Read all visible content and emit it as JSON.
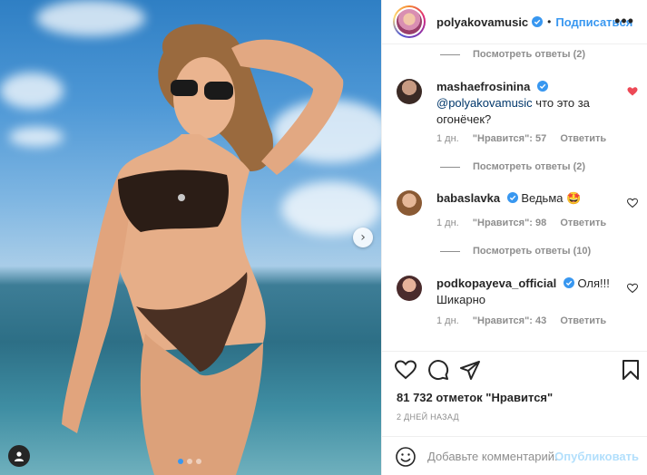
{
  "post": {
    "author": "polyakovamusic",
    "follow_label": "Подписаться",
    "more_label": "•••"
  },
  "replies": [
    {
      "label": "Посмотреть ответы (2)"
    },
    {
      "label": "Посмотреть ответы (2)"
    },
    {
      "label": "Посмотреть ответы (10)"
    }
  ],
  "comments": [
    {
      "user": "mashaefrosinina",
      "mention": "@polyakovamusic",
      "text": " что это за огонёчек?",
      "time": "1 дн.",
      "likes": "\"Нравится\": 57",
      "reply": "Ответить",
      "liked": true
    },
    {
      "user": "babaslavka",
      "mention": "",
      "text": "Ведьма 🤩",
      "time": "1 дн.",
      "likes": "\"Нравится\": 98",
      "reply": "Ответить",
      "liked": false
    },
    {
      "user": "podkopayeva_official",
      "mention": "",
      "text": "Оля!!! Шикарно",
      "time": "1 дн.",
      "likes": "\"Нравится\": 43",
      "reply": "Ответить",
      "liked": false
    }
  ],
  "actions": {
    "likes_count": "81 732 отметок \"Нравится\"",
    "timestamp": "2 ДНЕЙ НАЗАД"
  },
  "comment_box": {
    "placeholder": "Добавьте комментарий...",
    "post_label": "Опубликовать"
  },
  "icons": {
    "heart": "heart-icon",
    "comment": "comment-icon",
    "share": "share-icon",
    "save": "bookmark-icon",
    "emoji": "emoji-icon",
    "next": "chevron-right-icon",
    "user_tag": "user-icon"
  },
  "colors": {
    "accent": "#3897f0",
    "liked_heart": "#ed4956"
  }
}
